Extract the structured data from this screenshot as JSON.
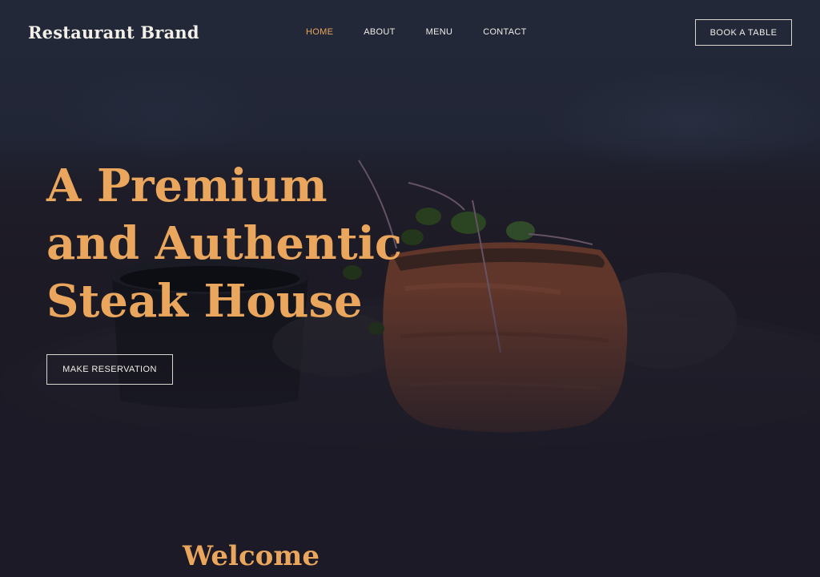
{
  "header": {
    "brand": "Restaurant Brand",
    "nav": [
      {
        "label": "HOME",
        "active": true
      },
      {
        "label": "ABOUT",
        "active": false
      },
      {
        "label": "MENU",
        "active": false
      },
      {
        "label": "CONTACT",
        "active": false
      }
    ],
    "cta_label": "BOOK A TABLE"
  },
  "hero": {
    "headline_lines": [
      "A Premium",
      "and Authentic",
      "Steak House"
    ],
    "button_label": "MAKE RESERVATION",
    "image": "steak-photo"
  },
  "welcome": {
    "title": "Welcome"
  },
  "colors": {
    "accent": "#e9a65c",
    "background": "#1c1a26",
    "text": "#f2efe8"
  }
}
